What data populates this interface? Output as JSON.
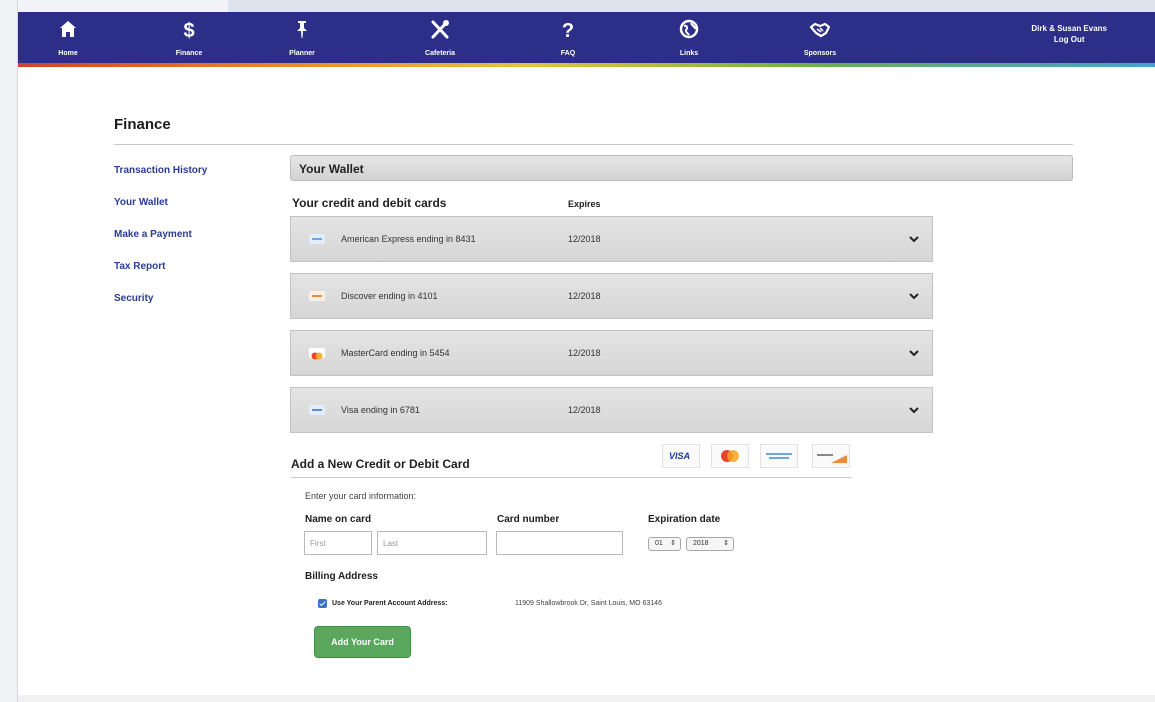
{
  "nav": {
    "items": [
      {
        "label": "Home",
        "icon": "home-icon"
      },
      {
        "label": "Finance",
        "icon": "dollar-icon"
      },
      {
        "label": "Planner",
        "icon": "pushpin-icon"
      },
      {
        "label": "Cafeteria",
        "icon": "fork-knife-icon"
      },
      {
        "label": "FAQ",
        "icon": "question-icon"
      },
      {
        "label": "Links",
        "icon": "globe-icon"
      },
      {
        "label": "Sponsors",
        "icon": "handshake-icon"
      }
    ],
    "user_name": "Dirk & Susan Evans",
    "logout_label": "Log Out"
  },
  "page": {
    "title": "Finance"
  },
  "sidebar": {
    "items": [
      {
        "label": "Transaction History"
      },
      {
        "label": "Your Wallet"
      },
      {
        "label": "Make a Payment"
      },
      {
        "label": "Tax Report"
      },
      {
        "label": "Security"
      }
    ]
  },
  "wallet": {
    "header": "Your Wallet",
    "cards_heading": "Your credit and debit cards",
    "expires_heading": "Expires",
    "cards": [
      {
        "name": "American Express ending in 8431",
        "expires": "12/2018",
        "icon": "amex-card-icon"
      },
      {
        "name": "Discover ending in 4101",
        "expires": "12/2018",
        "icon": "discover-card-icon"
      },
      {
        "name": "MasterCard ending in 5454",
        "expires": "12/2018",
        "icon": "mastercard-card-icon"
      },
      {
        "name": "Visa ending in 6781",
        "expires": "12/2018",
        "icon": "visa-card-icon"
      }
    ]
  },
  "add_card": {
    "heading": "Add a New Credit or Debit Card",
    "brand_visa": "VISA",
    "instructions": "Enter your card information:",
    "name_label": "Name on card",
    "first_placeholder": "First",
    "last_placeholder": "Last",
    "number_label": "Card number",
    "expiration_label": "Expiration date",
    "month_value": "01",
    "year_value": "2018",
    "billing_label": "Billing Address",
    "use_parent_label": "Use Your Parent Account Address:",
    "parent_address": "11909 Shallowbrook Dr, Saint Louis, MO 63146",
    "submit_label": "Add Your Card"
  },
  "colors": {
    "nav_bg": "#2c2e88",
    "link": "#2d3c93",
    "button": "#5aa85e",
    "checkbox": "#3a6fd1"
  }
}
